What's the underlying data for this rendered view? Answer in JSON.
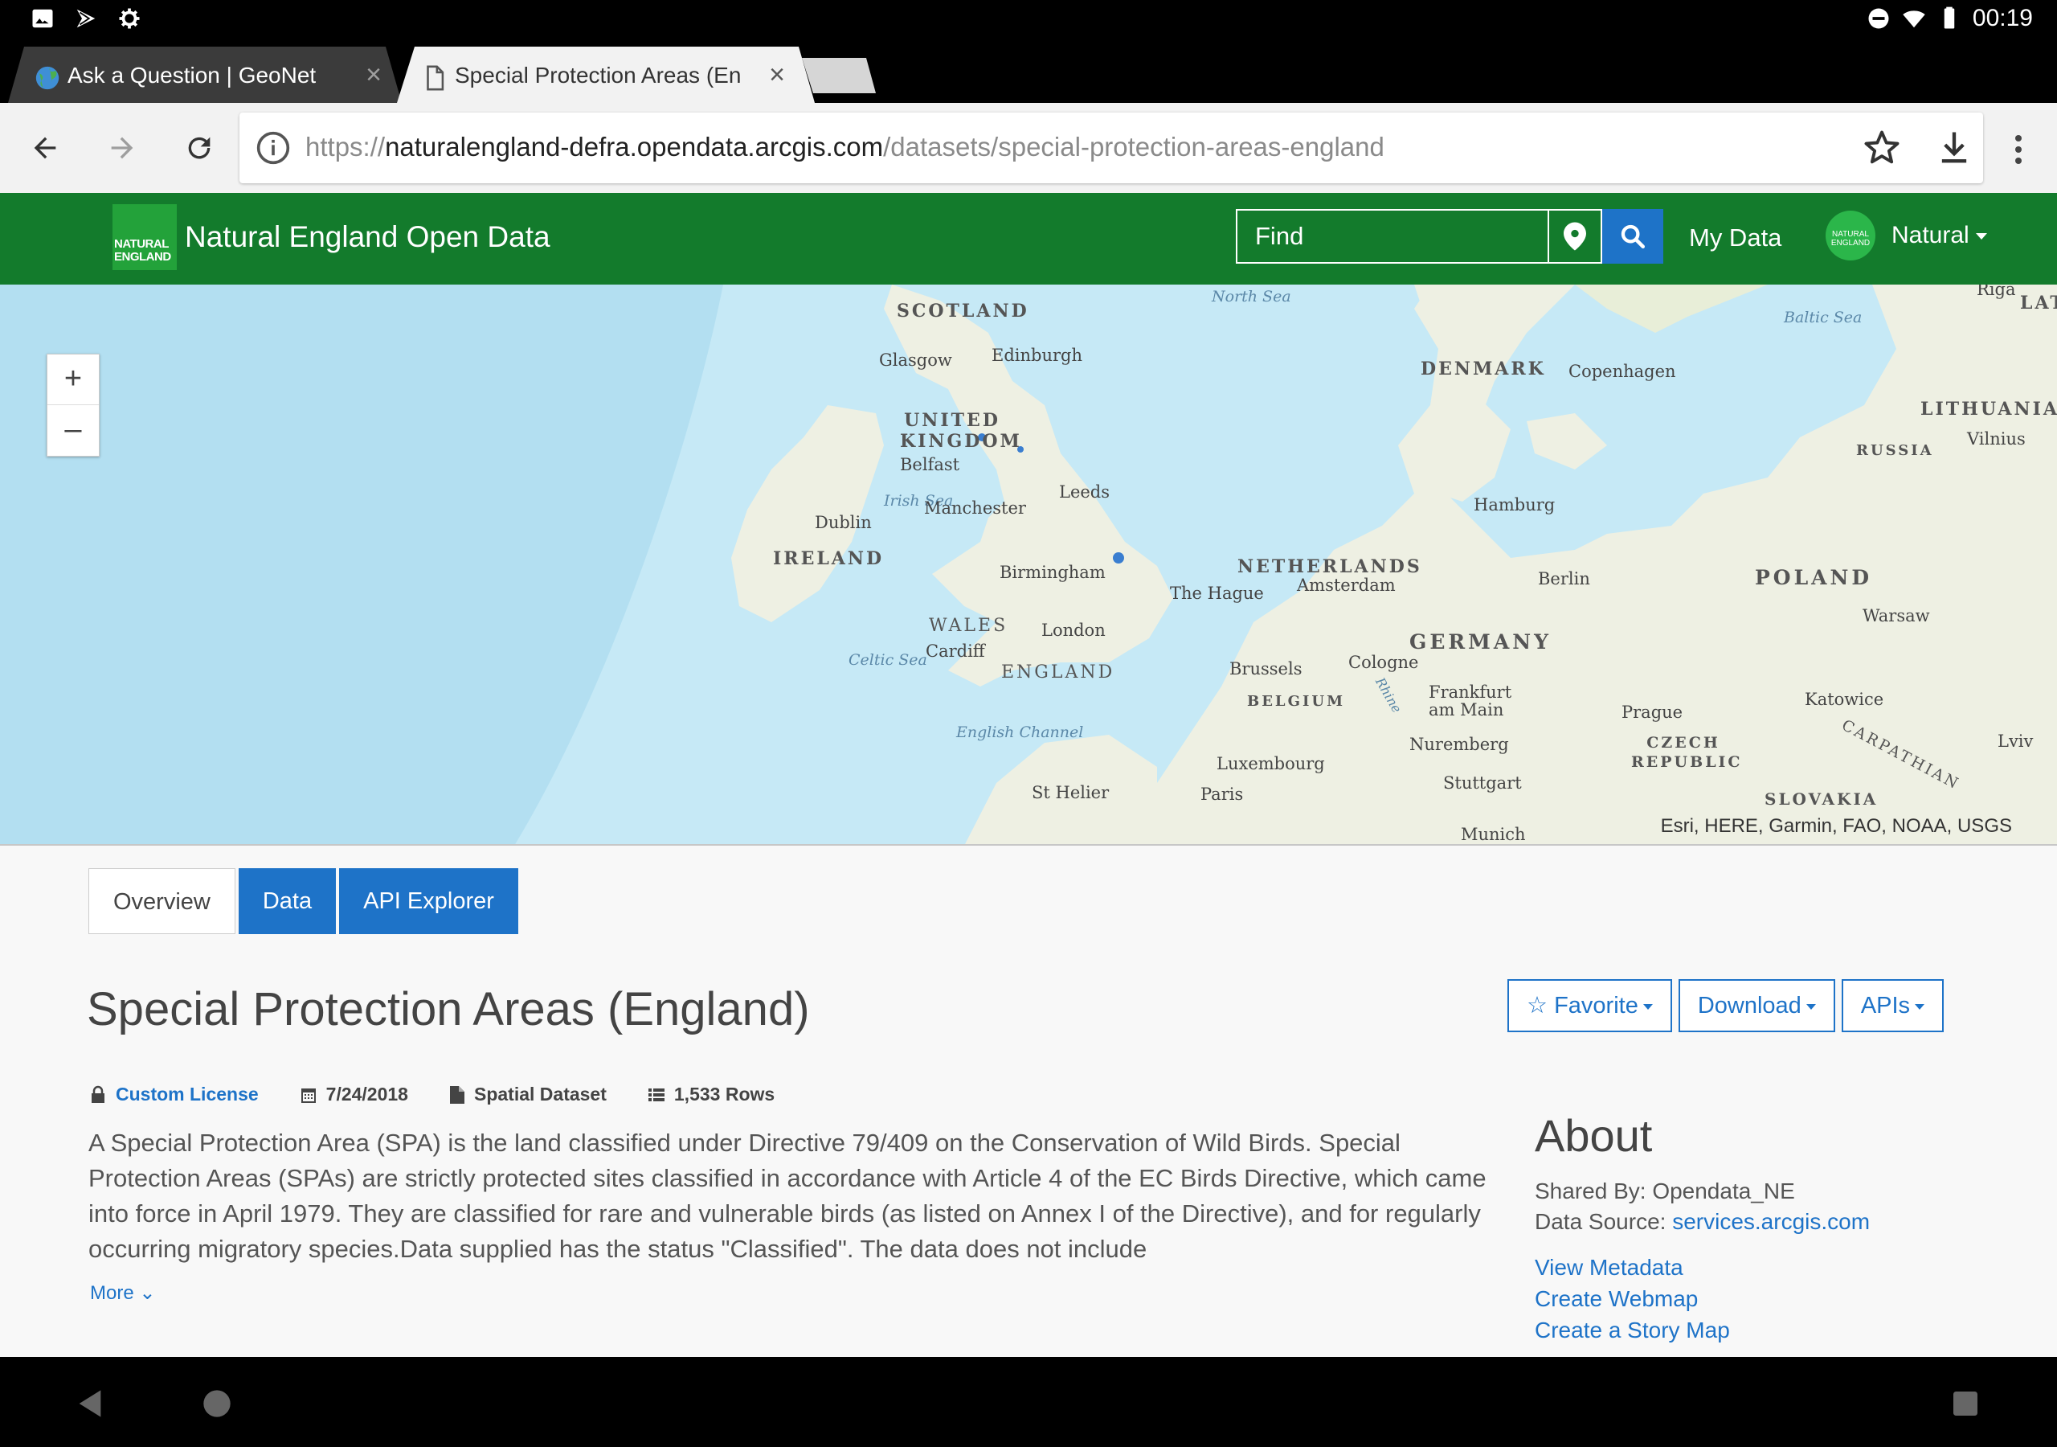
{
  "status_bar": {
    "time": "00:19",
    "left_icons": [
      "image-icon",
      "play-store-icon",
      "settings-sync-icon"
    ],
    "right_icons": [
      "dnd-icon",
      "wifi-icon",
      "battery-icon"
    ]
  },
  "browser": {
    "tabs": [
      {
        "title": "Ask a Question | GeoNet",
        "active": false
      },
      {
        "title": "Special Protection Areas (En",
        "active": true
      }
    ],
    "url_scheme": "https://",
    "url_host": "naturalengland-defra.opendata.arcgis.com",
    "url_path": "/datasets/special-protection-areas-england"
  },
  "site": {
    "logo_text_1": "NATURAL",
    "logo_text_2": "ENGLAND",
    "title": "Natural England Open Data",
    "search_placeholder": "Find",
    "my_data": "My Data",
    "avatar_text": "NATURAL ENGLAND",
    "user_name": "Natural",
    "brand_color": "#137b2c",
    "accent_color": "#1e73c8"
  },
  "map": {
    "zoom_in": "+",
    "zoom_out": "–",
    "attribution": "Esri, HERE, Garmin, FAO, NOAA, USGS",
    "labels": {
      "scotland": "SCOTLAND",
      "north_sea": "North Sea",
      "baltic_sea": "Baltic Sea",
      "riga": "Riga",
      "lat": "LAT",
      "glasgow": "Glasgow",
      "edinburgh": "Edinburgh",
      "denmark": "DENMARK",
      "copenhagen": "Copenhagen",
      "lithuania": "LITHUANIA",
      "vilnius": "Vilnius",
      "united_kingdom": "UNITED KINGDOM",
      "belfast": "Belfast",
      "russia": "RUSSIA",
      "leeds": "Leeds",
      "irish_sea": "Irish Sea",
      "manchester": "Manchester",
      "hamburg": "Hamburg",
      "dublin": "Dublin",
      "ireland": "IRELAND",
      "netherlands": "NETHERLANDS",
      "birmingham": "Birmingham",
      "amsterdam": "Amsterdam",
      "the_hague": "The Hague",
      "berlin": "Berlin",
      "poland": "POLAND",
      "wales": "WALES",
      "warsaw": "Warsaw",
      "cardiff": "Cardiff",
      "london": "London",
      "germany": "GERMANY",
      "celtic_sea": "Celtic Sea",
      "england": "ENGLAND",
      "brussels": "Brussels",
      "cologne": "Cologne",
      "belgium": "BELGIUM",
      "frankfurt": "Frankfurt am Main",
      "katowice": "Katowice",
      "prague": "Prague",
      "rhine": "Rhine",
      "english_channel": "English Channel",
      "nuremberg": "Nuremberg",
      "czech": "CZECH REPUBLIC",
      "lviv": "Lviv",
      "luxembourg": "Luxembourg",
      "carpathian": "CARPATHIAN",
      "st_helier": "St Helier",
      "paris": "Paris",
      "stuttgart": "Stuttgart",
      "slovakia": "SLOVAKIA",
      "munich": "Munich"
    }
  },
  "content": {
    "tabs": [
      "Overview",
      "Data",
      "API Explorer"
    ],
    "title": "Special Protection Areas (England)",
    "actions": {
      "favorite": "Favorite",
      "download": "Download",
      "apis": "APIs"
    },
    "meta": {
      "license": "Custom License",
      "date": "7/24/2018",
      "type": "Spatial Dataset",
      "rows": "1,533 Rows"
    },
    "description": "A Special Protection Area (SPA) is the land classified under Directive 79/409 on the Conservation of Wild Birds. Special Protection Areas (SPAs) are strictly protected sites classified in accordance with Article 4 of the EC Birds Directive, which came into force in April 1979. They are classified for rare and vulnerable birds (as listed on Annex I of the Directive), and for regularly occurring migratory species.Data supplied has the status \"Classified\". The data does not include",
    "more": "More",
    "about": {
      "heading": "About",
      "shared_by_label": "Shared By:",
      "shared_by": "Opendata_NE",
      "source_label": "Data Source:",
      "source": "services.arcgis.com",
      "links": [
        "View Metadata",
        "Create Webmap",
        "Create a Story Map"
      ]
    }
  }
}
